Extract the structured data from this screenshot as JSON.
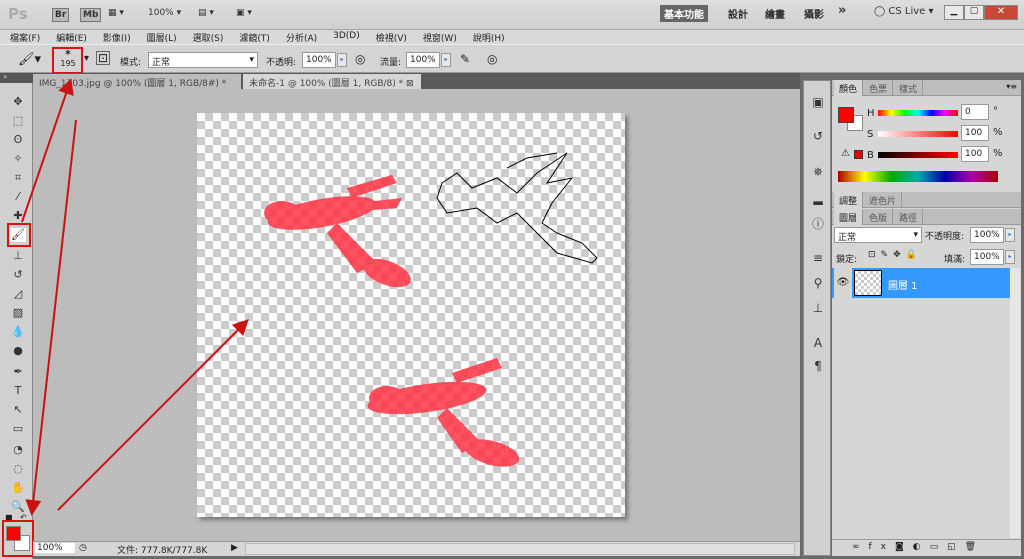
{
  "app": {
    "logo": "Ps",
    "br": "Br",
    "mb": "Mb",
    "zoom": "100%",
    "workspaces": [
      "基本功能",
      "設計",
      "繪畫",
      "攝影"
    ],
    "more": "»",
    "cs_live": "CS Live"
  },
  "menu": [
    "檔案(F)",
    "編輯(E)",
    "影像(I)",
    "圖層(L)",
    "選取(S)",
    "濾鏡(T)",
    "分析(A)",
    "3D(D)",
    "檢視(V)",
    "視窗(W)",
    "說明(H)"
  ],
  "options": {
    "brush_size": "195",
    "mode_label": "模式:",
    "mode_value": "正常",
    "opacity_label": "不透明:",
    "opacity_value": "100%",
    "flow_label": "流量:",
    "flow_value": "100%"
  },
  "tabs": [
    {
      "label": "IMG_1703.jpg @ 100% (圖層 1, RGB/8#) *",
      "active": false
    },
    {
      "label": "未命名-1 @ 100% (圖層 1, RGB/8) *",
      "active": true
    }
  ],
  "status": {
    "zoom": "100%",
    "file": "文件: 777.8K/777.8K"
  },
  "color_panel": {
    "tabs": [
      "顏色",
      "色票",
      "樣式"
    ],
    "h_label": "H",
    "h_value": "0",
    "h_unit": "°",
    "s_label": "S",
    "s_value": "100",
    "s_unit": "%",
    "b_label": "B",
    "b_value": "100",
    "b_unit": "%",
    "foreground": "#ff0000",
    "background": "#ffffff"
  },
  "adjust_panel": {
    "tabs": [
      "調整",
      "遮色片"
    ]
  },
  "layers_panel": {
    "tabs": [
      "圖層",
      "色版",
      "路徑"
    ],
    "blend": "正常",
    "opacity_label": "不透明度:",
    "opacity_value": "100%",
    "lock_label": "鎖定:",
    "fill_label": "填滿:",
    "fill_value": "100%",
    "layers": [
      {
        "name": "圖層 1",
        "selected": true
      }
    ]
  },
  "colors": {
    "accent": "#3399ff",
    "annotation": "#cc1111",
    "paint": "#ff3344"
  }
}
